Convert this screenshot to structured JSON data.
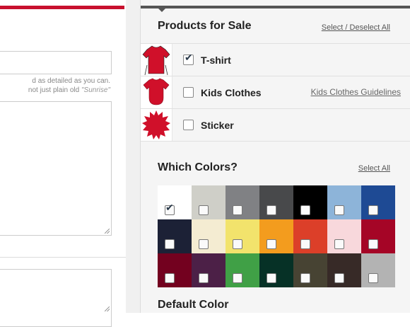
{
  "left_form": {
    "hint_line1": "d as detailed as you can.",
    "hint_line2_prefix": "not just plain old",
    "hint_line2_example": "\"Sunrise\""
  },
  "products": {
    "title": "Products for Sale",
    "select_link": "Select / Deselect All",
    "items": [
      {
        "label": "T-shirt",
        "checked": true,
        "icon": "tshirt-icon"
      },
      {
        "label": "Kids Clothes",
        "checked": false,
        "icon": "kids-onesie-icon",
        "guide_link": "Kids Clothes Guidelines"
      },
      {
        "label": "Sticker",
        "checked": false,
        "icon": "sticker-starburst-icon"
      }
    ]
  },
  "colors": {
    "title": "Which Colors?",
    "select_link": "Select All",
    "swatches": [
      {
        "name": "white",
        "hex": "#ffffff",
        "checked": true
      },
      {
        "name": "light-grey",
        "hex": "#cfcfc8",
        "checked": false
      },
      {
        "name": "grey",
        "hex": "#808184",
        "checked": false
      },
      {
        "name": "charcoal",
        "hex": "#48494b",
        "checked": false
      },
      {
        "name": "black",
        "hex": "#000000",
        "checked": false
      },
      {
        "name": "light-blue",
        "hex": "#8db4d9",
        "checked": false
      },
      {
        "name": "royal-blue",
        "hex": "#1e4a94",
        "checked": false
      },
      {
        "name": "navy",
        "hex": "#1c2136",
        "checked": false
      },
      {
        "name": "cream",
        "hex": "#f4ecd2",
        "checked": false
      },
      {
        "name": "lemon",
        "hex": "#f2e36c",
        "checked": false
      },
      {
        "name": "orange",
        "hex": "#f39c1e",
        "checked": false
      },
      {
        "name": "red-orange",
        "hex": "#dc3f29",
        "checked": false
      },
      {
        "name": "pink",
        "hex": "#f8d8dc",
        "checked": false
      },
      {
        "name": "red",
        "hex": "#a50526",
        "checked": false
      },
      {
        "name": "maroon",
        "hex": "#73011f",
        "checked": false
      },
      {
        "name": "purple",
        "hex": "#4c2047",
        "checked": false
      },
      {
        "name": "green",
        "hex": "#40a046",
        "checked": false
      },
      {
        "name": "dark-green",
        "hex": "#063126",
        "checked": false
      },
      {
        "name": "olive",
        "hex": "#474333",
        "checked": false
      },
      {
        "name": "dark-brown",
        "hex": "#372a27",
        "checked": false
      },
      {
        "name": "silver",
        "hex": "#b3b3b3",
        "checked": false
      }
    ]
  },
  "default_color": {
    "title": "Default Color"
  },
  "accent_colors": {
    "brand_red": "#c8102e",
    "panel_bg": "#f5f5f5"
  }
}
